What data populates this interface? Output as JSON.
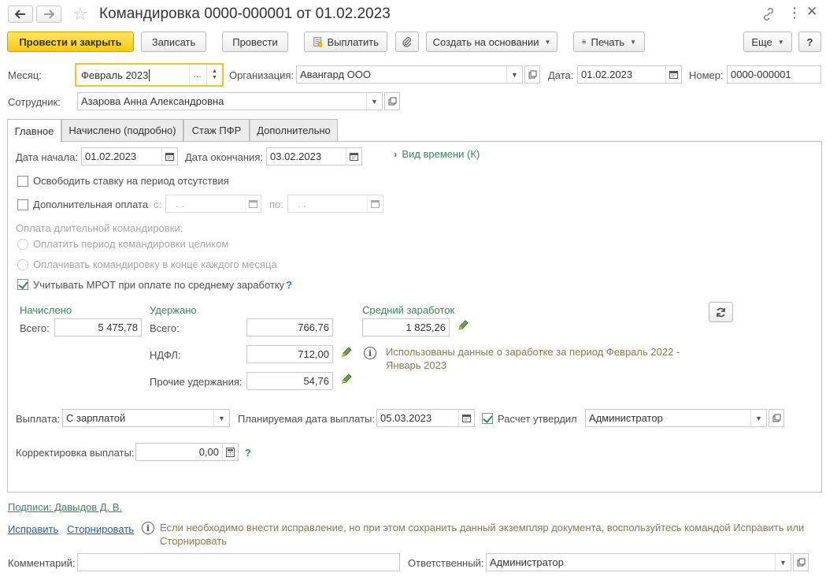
{
  "window": {
    "title": "Командировка 0000-000001 от 01.02.2023"
  },
  "toolbar": {
    "post_close": "Провести и закрыть",
    "save": "Записать",
    "post": "Провести",
    "pay": "Выплатить",
    "create_based": "Создать на основании",
    "print": "Печать",
    "more": "Еще",
    "help": "?"
  },
  "header": {
    "month_label": "Месяц:",
    "month_value": "Февраль 2023",
    "org_label": "Организация:",
    "org_value": "Авангард ООО",
    "date_label": "Дата:",
    "date_value": "01.02.2023",
    "number_label": "Номер:",
    "number_value": "0000-000001",
    "employee_label": "Сотрудник:",
    "employee_value": "Азарова Анна Александровна"
  },
  "tabs": [
    {
      "label": "Главное",
      "active": true
    },
    {
      "label": "Начислено (подробно)",
      "active": false
    },
    {
      "label": "Стаж ПФР",
      "active": false
    },
    {
      "label": "Дополнительно",
      "active": false
    }
  ],
  "main": {
    "start_label": "Дата начала:",
    "start_value": "01.02.2023",
    "end_label": "Дата окончания:",
    "end_value": "03.02.2023",
    "time_kind_link": "Вид времени (К)",
    "free_rate": {
      "label": "Освободить ставку на период отсутствия",
      "checked": false
    },
    "extra_pay": {
      "label": "Дополнительная оплата",
      "checked": false
    },
    "from_label": "с:",
    "from_value": ".  .",
    "to_label": "по:",
    "to_value": ".  .",
    "long_trip_label": "Оплата длительной командировки:",
    "radio_whole": "Оплатить период командировки целиком",
    "radio_monthly": "Оплачивать командировку в конце каждого месяца",
    "mrot": {
      "label": "Учитывать МРОТ при оплате по среднему заработку",
      "checked": true
    },
    "help_mark": "?",
    "accrued_header": "Начислено",
    "withheld_header": "Удержано",
    "avg_header": "Средний заработок",
    "total_label": "Всего:",
    "accrued_total": "5 475,78",
    "withheld_total_label": "Всего:",
    "withheld_total": "766,76",
    "avg_value": "1 825,26",
    "ndfl_label": "НДФЛ:",
    "ndfl_value": "712,00",
    "other_label": "Прочие удержания:",
    "other_value": "54,76",
    "info_text_1": "Использованы данные о заработке за период Февраль 2022 -",
    "info_text_2": "Январь 2023",
    "payout_label": "Выплата:",
    "payout_value": "С зарплатой",
    "planned_label": "Планируемая дата выплаты:",
    "planned_value": "05.03.2023",
    "approved": {
      "label": "Расчет утвердил",
      "checked": true
    },
    "approver_value": "Администратор",
    "correction_label": "Корректировка выплаты:",
    "correction_value": "0,00"
  },
  "footer": {
    "signatures_link": "Подписи: Давыдов Д. В.",
    "fix_link": "Исправить",
    "storno_link": "Сторнировать",
    "notice_1": "Если необходимо внести исправление, но при этом сохранить данный экземпляр документа, воспользуйтесь командой Исправить или",
    "notice_2": "Сторнировать",
    "comment_label": "Комментарий:",
    "comment_value": "",
    "responsible_label": "Ответственный:",
    "responsible_value": "Администратор"
  },
  "colors": {
    "accent_green": "#2e8b57",
    "primary_button": "#f6c90e",
    "link_blue": "#1f5fa8"
  }
}
